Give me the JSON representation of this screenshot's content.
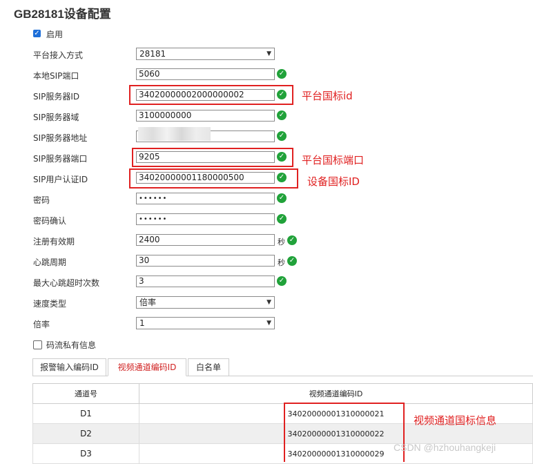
{
  "page": {
    "title": "GB28181设备配置"
  },
  "enable": {
    "label": "启用",
    "checked": true
  },
  "form": {
    "access_mode": {
      "label": "平台接入方式",
      "value": "28181"
    },
    "local_port": {
      "label": "本地SIP端口",
      "value": "5060"
    },
    "server_id": {
      "label": "SIP服务器ID",
      "value": "34020000002000000002"
    },
    "server_domain": {
      "label": "SIP服务器域",
      "value": "3100000000"
    },
    "server_address": {
      "label": "SIP服务器地址",
      "value": ""
    },
    "server_port": {
      "label": "SIP服务器端口",
      "value": "9205"
    },
    "user_auth_id": {
      "label": "SIP用户认证ID",
      "value": "34020000001180000500"
    },
    "password": {
      "label": "密码",
      "value": "••••••"
    },
    "password_confirm": {
      "label": "密码确认",
      "value": "••••••"
    },
    "register_valid": {
      "label": "注册有效期",
      "value": "2400",
      "unit": "秒"
    },
    "heartbeat": {
      "label": "心跳周期",
      "value": "30",
      "unit": "秒"
    },
    "max_timeout": {
      "label": "最大心跳超时次数",
      "value": "3"
    },
    "speed_type": {
      "label": "速度类型",
      "value": "倍率"
    },
    "rate": {
      "label": "倍率",
      "value": "1"
    }
  },
  "private_info": {
    "label": "码流私有信息",
    "checked": false
  },
  "annotations": {
    "server_id": "平台国标id",
    "server_port": "平台国标端口",
    "device_id": "设备国标ID",
    "channel_info": "视频通道国标信息"
  },
  "tabs": [
    "报警输入编码ID",
    "视频通道编码ID",
    "白名单"
  ],
  "table": {
    "headers": [
      "通道号",
      "视频通道编码ID"
    ],
    "rows": [
      {
        "channel": "D1",
        "id": "34020000001310000021"
      },
      {
        "channel": "D2",
        "id": "34020000001310000022"
      },
      {
        "channel": "D3",
        "id": "34020000001310000029"
      }
    ]
  },
  "watermark": "CSDN @hzhouhangkeji",
  "colors": {
    "accent": "#1e6fd9",
    "ok": "#21a23a",
    "annotation": "#e02020"
  }
}
